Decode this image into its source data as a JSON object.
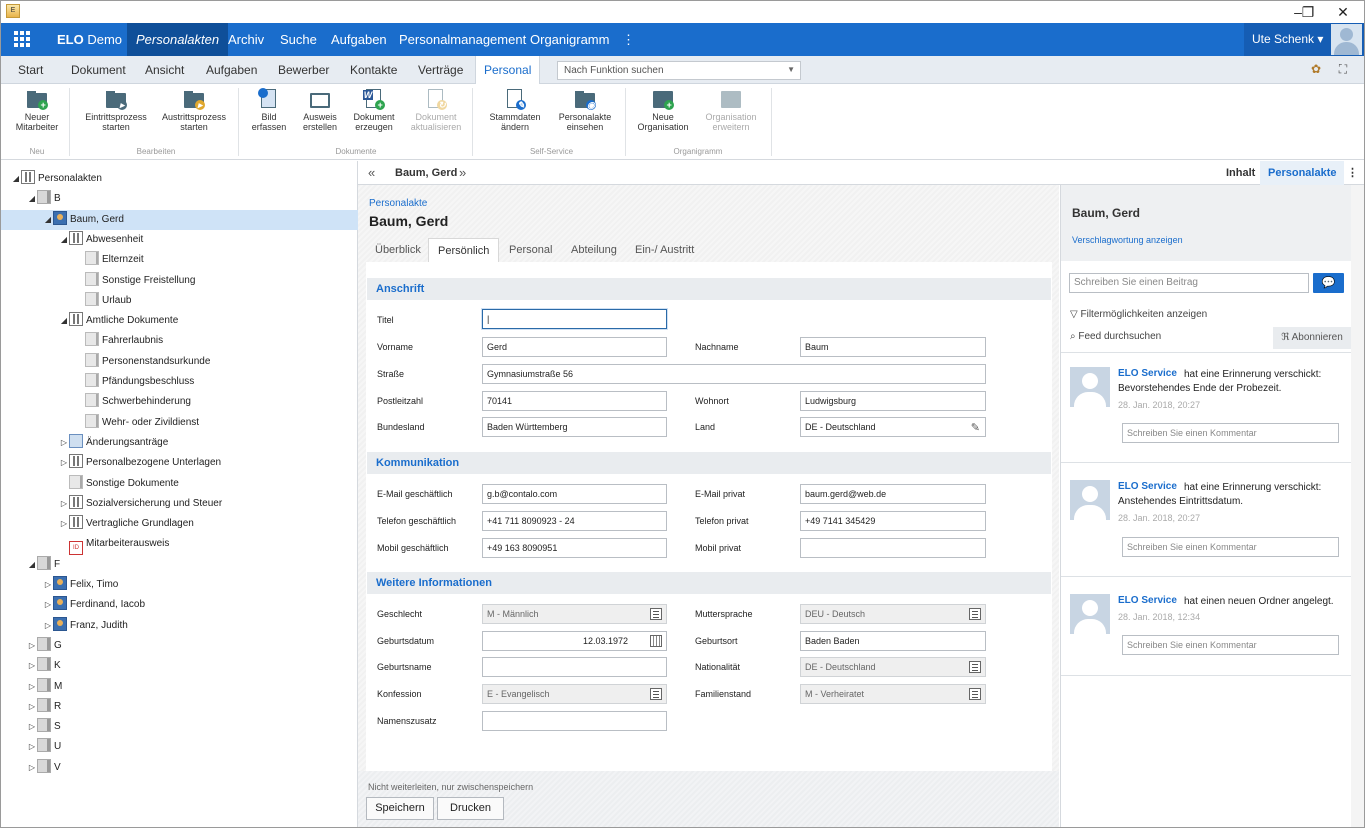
{
  "window": {
    "minimize": "–",
    "restore": "❐",
    "close": "✕"
  },
  "nav": {
    "brand_bold": "ELO",
    "brand_rest": "Demo",
    "items": [
      "Personalakten",
      "Archiv",
      "Suche",
      "Aufgaben",
      "Personalmanagement",
      "Organigramm",
      "⋮"
    ],
    "user": "Ute Schenk ▾"
  },
  "ribbon_tabs": [
    "Start",
    "Dokument",
    "Ansicht",
    "Aufgaben",
    "Bewerber",
    "Kontakte",
    "Verträge",
    "Personal"
  ],
  "function_search": {
    "placeholder": "Nach Funktion suchen"
  },
  "ribbon": {
    "buttons": [
      {
        "l1": "Neuer",
        "l2": "Mitarbeiter",
        "icon": "add-employee-folder-icon"
      },
      {
        "l1": "Eintrittsprozess",
        "l2": "starten",
        "icon": "entry-process-icon"
      },
      {
        "l1": "Austrittsprozess",
        "l2": "starten",
        "icon": "exit-process-icon"
      },
      {
        "l1": "Bild",
        "l2": "erfassen",
        "icon": "capture-image-icon"
      },
      {
        "l1": "Ausweis",
        "l2": "erstellen",
        "icon": "id-card-icon"
      },
      {
        "l1": "Dokument",
        "l2": "erzeugen",
        "icon": "word-document-icon"
      },
      {
        "l1": "Dokument",
        "l2": "aktualisieren",
        "icon": "update-document-icon"
      },
      {
        "l1": "Stammdaten",
        "l2": "ändern",
        "icon": "edit-master-data-icon"
      },
      {
        "l1": "Personalakte",
        "l2": "einsehen",
        "icon": "view-personnel-file-icon"
      },
      {
        "l1": "Neue",
        "l2": "Organisation",
        "icon": "new-organization-icon"
      },
      {
        "l1": "Organisation",
        "l2": "erweitern",
        "icon": "extend-organization-icon"
      }
    ],
    "groups": [
      "Neu",
      "Bearbeiten",
      "Dokumente",
      "Self-Service",
      "Organigramm"
    ]
  },
  "tree": [
    {
      "label": "Personalakten",
      "tg": "◢",
      "icon": "bind"
    },
    {
      "label": "B",
      "tg": "◢",
      "icon": "reg"
    },
    {
      "label": "Baum, Gerd",
      "tg": "◢",
      "icon": "pers"
    },
    {
      "label": "Abwesenheit",
      "tg": "◢",
      "icon": "bind"
    },
    {
      "label": "Elternzeit",
      "tg": "",
      "icon": "doc"
    },
    {
      "label": "Sonstige Freistellung",
      "tg": "",
      "icon": "doc"
    },
    {
      "label": "Urlaub",
      "tg": "",
      "icon": "doc"
    },
    {
      "label": "Amtliche Dokumente",
      "tg": "◢",
      "icon": "bind"
    },
    {
      "label": "Fahrerlaubnis",
      "tg": "",
      "icon": "doc"
    },
    {
      "label": "Personenstandsurkunde",
      "tg": "",
      "icon": "doc"
    },
    {
      "label": "Pfändungsbeschluss",
      "tg": "",
      "icon": "doc"
    },
    {
      "label": "Schwerbehinderung",
      "tg": "",
      "icon": "doc"
    },
    {
      "label": "Wehr- oder Zivildienst",
      "tg": "",
      "icon": "doc"
    },
    {
      "label": "Änderungsanträge",
      "tg": "▷",
      "icon": "form"
    },
    {
      "label": "Personalbezogene Unterlagen",
      "tg": "▷",
      "icon": "bind"
    },
    {
      "label": "Sonstige Dokumente",
      "tg": "",
      "icon": "doc"
    },
    {
      "label": "Sozialversicherung und Steuer",
      "tg": "▷",
      "icon": "bind"
    },
    {
      "label": "Vertragliche Grundlagen",
      "tg": "▷",
      "icon": "bind"
    },
    {
      "label": "Mitarbeiterausweis",
      "tg": "",
      "icon": "card"
    },
    {
      "label": "F",
      "tg": "◢",
      "icon": "reg"
    },
    {
      "label": "Felix, Timo",
      "tg": "▷",
      "icon": "pers"
    },
    {
      "label": "Ferdinand, Iacob",
      "tg": "▷",
      "icon": "pers"
    },
    {
      "label": "Franz, Judith",
      "tg": "▷",
      "icon": "pers"
    },
    {
      "label": "G",
      "tg": "▷",
      "icon": "reg"
    },
    {
      "label": "K",
      "tg": "▷",
      "icon": "reg"
    },
    {
      "label": "M",
      "tg": "▷",
      "icon": "reg"
    },
    {
      "label": "R",
      "tg": "▷",
      "icon": "reg"
    },
    {
      "label": "S",
      "tg": "▷",
      "icon": "reg"
    },
    {
      "label": "U",
      "tg": "▷",
      "icon": "reg"
    },
    {
      "label": "V",
      "tg": "▷",
      "icon": "reg"
    }
  ],
  "crumb": {
    "back": "«",
    "title": "Baum, Gerd",
    "fwd": "»",
    "tabs": [
      "Inhalt",
      "Personalakte"
    ],
    "more": "⋮"
  },
  "form": {
    "link": "Personalakte",
    "title": "Baum, Gerd",
    "tabs": [
      "Überblick",
      "Persönlich",
      "Personal",
      "Abteilung",
      "Ein-/ Austritt"
    ],
    "sections": [
      "Anschrift",
      "Kommunikation",
      "Weitere Informationen"
    ],
    "fields": {
      "titel": {
        "label": "Titel",
        "value": ""
      },
      "vorname": {
        "label": "Vorname",
        "value": "Gerd"
      },
      "nachname": {
        "label": "Nachname",
        "value": "Baum"
      },
      "strasse": {
        "label": "Straße",
        "value": "Gymnasiumstraße 56"
      },
      "plz": {
        "label": "Postleitzahl",
        "value": "70141"
      },
      "wohnort": {
        "label": "Wohnort",
        "value": "Ludwigsburg"
      },
      "bundesland": {
        "label": "Bundesland",
        "value": "Baden Württemberg"
      },
      "land": {
        "label": "Land",
        "value": "DE - Deutschland"
      },
      "email_g": {
        "label": "E-Mail geschäftlich",
        "value": "g.b@contalo.com"
      },
      "email_p": {
        "label": "E-Mail privat",
        "value": "baum.gerd@web.de"
      },
      "tel_g": {
        "label": "Telefon geschäftlich",
        "value": "+41 711 8090923 - 24"
      },
      "tel_p": {
        "label": "Telefon privat",
        "value": "+49 7141 345429"
      },
      "mobil_g": {
        "label": "Mobil geschäftlich",
        "value": "+49 163 8090951"
      },
      "mobil_p": {
        "label": "Mobil privat",
        "value": ""
      },
      "geschlecht": {
        "label": "Geschlecht",
        "value": "M - Männlich"
      },
      "muttersprache": {
        "label": "Muttersprache",
        "value": "DEU - Deutsch"
      },
      "gebdatum": {
        "label": "Geburtsdatum",
        "value": "12.03.1972"
      },
      "geburtsort": {
        "label": "Geburtsort",
        "value": "Baden Baden"
      },
      "gebname": {
        "label": "Geburtsname",
        "value": ""
      },
      "nationalitaet": {
        "label": "Nationalität",
        "value": "DE - Deutschland"
      },
      "konfession": {
        "label": "Konfession",
        "value": "E - Evangelisch"
      },
      "familienstand": {
        "label": "Familienstand",
        "value": "M - Verheiratet"
      },
      "namenszusatz": {
        "label": "Namenszusatz",
        "value": ""
      }
    },
    "note": "Nicht weiterleiten, nur zwischenspeichern",
    "save": "Speichern",
    "print": "Drucken"
  },
  "feed": {
    "name": "Baum, Gerd",
    "tags_link": "Verschlagwortung anzeigen",
    "post_placeholder": "Schreiben Sie einen Beitrag",
    "filter": "Filtermöglichkeiten anzeigen",
    "search": "Feed durchsuchen",
    "subscribe": "Abonnieren",
    "comment_placeholder": "Schreiben Sie einen Kommentar",
    "entries": [
      {
        "who": "ELO Service",
        "action": "hat eine Erinnerung verschickt:",
        "msg": "Bevorstehendes Ende der Probezeit.",
        "ts": "28. Jan. 2018, 20:27"
      },
      {
        "who": "ELO Service",
        "action": "hat eine Erinnerung verschickt:",
        "msg": "Anstehendes Eintrittsdatum.",
        "ts": "28. Jan. 2018, 20:27"
      },
      {
        "who": "ELO Service",
        "action": "hat einen neuen Ordner angelegt.",
        "msg": "",
        "ts": "28. Jan. 2018, 12:34"
      }
    ]
  },
  "colors": {
    "accent": "#1a6dcc",
    "nav_active": "#0f4f99"
  }
}
